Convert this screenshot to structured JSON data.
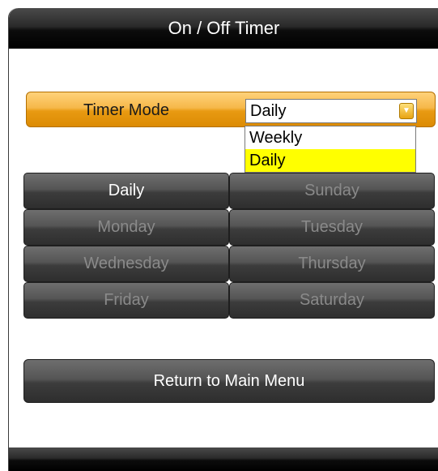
{
  "header": {
    "title": "On / Off Timer"
  },
  "timer_mode": {
    "label": "Timer Mode",
    "selected_value": "Daily",
    "options": [
      {
        "label": "Weekly",
        "selected": false
      },
      {
        "label": "Daily",
        "selected": true
      }
    ]
  },
  "days": [
    {
      "label": "Daily",
      "enabled": true
    },
    {
      "label": "Sunday",
      "enabled": false
    },
    {
      "label": "Monday",
      "enabled": false
    },
    {
      "label": "Tuesday",
      "enabled": false
    },
    {
      "label": "Wednesday",
      "enabled": false
    },
    {
      "label": "Thursday",
      "enabled": false
    },
    {
      "label": "Friday",
      "enabled": false
    },
    {
      "label": "Saturday",
      "enabled": false
    }
  ],
  "footer": {
    "return_label": "Return to Main Menu"
  },
  "colors": {
    "accent": "#e89a12",
    "dropdown_highlight": "#ffff00",
    "bar": "#000000",
    "button": "#4a4a4a",
    "disabled_text": "#8a8a8a"
  },
  "icons": {
    "dropdown": "chevron-down-icon"
  }
}
